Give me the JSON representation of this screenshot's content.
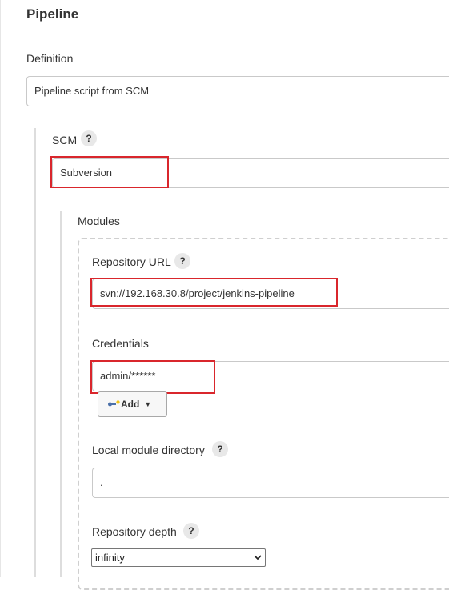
{
  "pipeline": {
    "title": "Pipeline",
    "definition": {
      "label": "Definition",
      "value": "Pipeline script from SCM"
    },
    "scm": {
      "label": "SCM",
      "help": "?",
      "value": "Subversion",
      "modules": {
        "label": "Modules",
        "repository_url": {
          "label": "Repository URL",
          "help": "?",
          "value": "svn://192.168.30.8/project/jenkins-pipeline"
        },
        "credentials": {
          "label": "Credentials",
          "value": "admin/******",
          "add_label": "Add"
        },
        "local_module_directory": {
          "label": "Local module directory",
          "help": "?",
          "value": "."
        },
        "repository_depth": {
          "label": "Repository depth",
          "help": "?",
          "value": "infinity"
        }
      }
    }
  },
  "colors": {
    "highlight": "#d9262c",
    "border": "#c9c9c9",
    "help_bg": "#e8e8e8"
  },
  "icons": {
    "add": "key-add-icon",
    "dropdown": "caret-down-icon"
  }
}
